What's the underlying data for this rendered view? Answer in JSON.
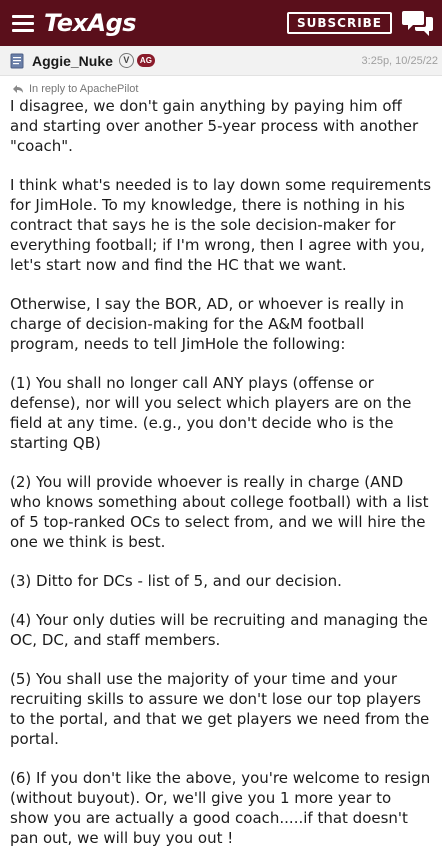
{
  "header": {
    "site_name": "TexAgs",
    "subscribe_label": "SUBSCRIBE",
    "menu_icon": "hamburger-menu-icon",
    "chat_icon": "chat-bubbles-icon",
    "bar_color": "#5a0f1b"
  },
  "post": {
    "author": "Aggie_Nuke",
    "badge_v": "V",
    "badge_ag": "AG",
    "timestamp": "3:25p, 10/25/22",
    "reply_to": "In reply to ApachePilot",
    "paragraphs": [
      "I disagree, we don't gain anything by paying him off and starting over another 5-year process with another \"coach\".",
      "I think what's needed is to lay down some requirements for JimHole. To my knowledge, there is nothing in his contract that says he is the sole decision-maker for everything football; if I'm wrong, then I agree with you, let's start now and find the HC that we want.",
      "Otherwise, I say the BOR, AD, or whoever is really in charge of decision-making for the A&M football program, needs to tell JimHole the following:",
      "(1) You shall no longer call ANY plays (offense or defense), nor will you select which players are on the field at any time. (e.g., you don't decide who is the starting QB)",
      "(2) You will provide whoever is really in charge (AND who knows something about college football) with a list of 5 top-ranked OCs to select from, and we will hire the one we think is best.",
      "(3) Ditto for DCs - list of 5, and our decision.",
      "(4) Your only duties will be recruiting and managing the OC, DC, and staff members.",
      "(5) You shall use the majority of your time and your recruiting skills to assure we don't lose our top players to the portal, and that we get players we need from the portal.",
      "(6) If you don't like the above, you're welcome to resign (without buyout). Or, we'll give you 1 more year to show you are actually a good coach.....if that doesn't pan out, we will buy you out !"
    ]
  }
}
